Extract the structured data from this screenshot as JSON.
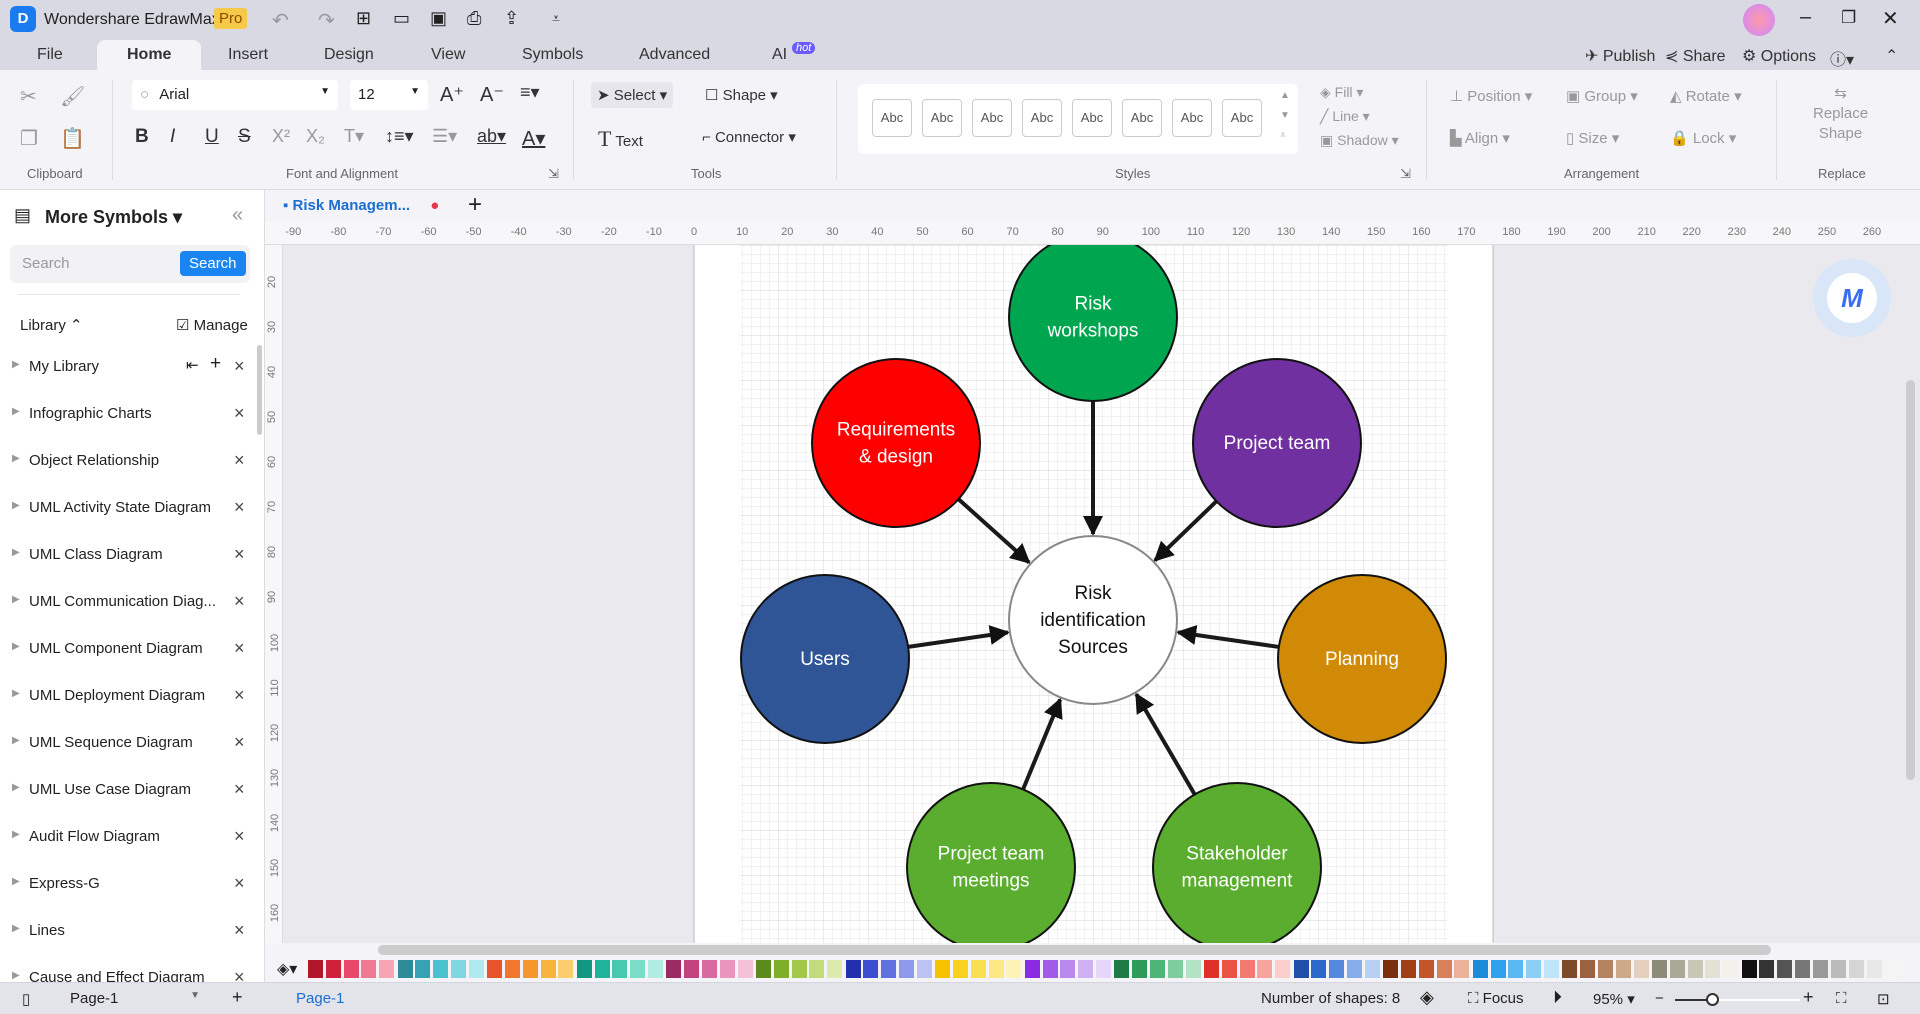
{
  "app": {
    "title": "Wondershare EdrawMax",
    "badge": "Pro"
  },
  "menu_tabs": [
    {
      "label": "File"
    },
    {
      "label": "Home"
    },
    {
      "label": "Insert"
    },
    {
      "label": "Design"
    },
    {
      "label": "View"
    },
    {
      "label": "Symbols"
    },
    {
      "label": "Advanced"
    },
    {
      "label": "AI"
    }
  ],
  "ai_badge": "hot",
  "top_actions": {
    "publish": "Publish",
    "share": "Share",
    "options": "Options"
  },
  "ribbon": {
    "clipboard": "Clipboard",
    "font_group": "Font and Alignment",
    "font": "Arial",
    "font_size": "12",
    "tools_group": "Tools",
    "select": "Select",
    "shape": "Shape",
    "text": "Text",
    "connector": "Connector",
    "styles_group": "Styles",
    "style_samples": [
      "Abc",
      "Abc",
      "Abc",
      "Abc",
      "Abc",
      "Abc",
      "Abc",
      "Abc"
    ],
    "fill": "Fill",
    "line": "Line",
    "shadow": "Shadow",
    "arrangement_group": "Arrangement",
    "position": "Position",
    "group": "Group",
    "rotate": "Rotate",
    "align": "Align",
    "size": "Size",
    "lock": "Lock",
    "replace_group": "Replace",
    "replace_shape_1": "Replace",
    "replace_shape_2": "Shape"
  },
  "sidebar": {
    "title": "More Symbols",
    "search_placeholder": "Search",
    "search_button": "Search",
    "library": "Library",
    "manage": "Manage",
    "items": [
      {
        "label": "My Library"
      },
      {
        "label": "Infographic Charts"
      },
      {
        "label": "Object Relationship"
      },
      {
        "label": "UML Activity State Diagram"
      },
      {
        "label": "UML Class Diagram"
      },
      {
        "label": "UML Communication Diag..."
      },
      {
        "label": "UML Component Diagram"
      },
      {
        "label": "UML Deployment Diagram"
      },
      {
        "label": "UML Sequence Diagram"
      },
      {
        "label": "UML Use Case Diagram"
      },
      {
        "label": "Audit Flow Diagram"
      },
      {
        "label": "Express-G"
      },
      {
        "label": "Lines"
      },
      {
        "label": "Cause and Effect Diagram"
      }
    ]
  },
  "document": {
    "tab": "Risk Managem..."
  },
  "ruler": {
    "h": [
      -90,
      -80,
      -70,
      -60,
      -50,
      -40,
      -30,
      -20,
      -10,
      0,
      10,
      20,
      30,
      40,
      50,
      60,
      70,
      80,
      90,
      100,
      110,
      120,
      130,
      140,
      150,
      160,
      170,
      180,
      190,
      200,
      210,
      220,
      230,
      240,
      250,
      260
    ],
    "v": [
      20,
      30,
      40,
      50,
      60,
      70,
      80,
      90,
      100,
      110,
      120,
      130,
      140,
      150,
      160
    ]
  },
  "diagram": {
    "center": {
      "line1": "Risk",
      "line2": "identification",
      "line3": "Sources",
      "color": "#ffffff"
    },
    "nodes": [
      {
        "line1": "Risk",
        "line2": "workshops",
        "color": "#00a64f"
      },
      {
        "line1": "Requirements",
        "line2": "& design",
        "color": "#ff0000"
      },
      {
        "line1": "Project team",
        "line2": "",
        "color": "#7030a0"
      },
      {
        "line1": "Users",
        "line2": "",
        "color": "#2f5597"
      },
      {
        "line1": "Planning",
        "line2": "",
        "color": "#d08a06"
      },
      {
        "line1": "Project team",
        "line2": "meetings",
        "color": "#5aad2e"
      },
      {
        "line1": "Stakeholder",
        "line2": "management",
        "color": "#5aad2e"
      }
    ]
  },
  "palette": [
    "#b3162b",
    "#d1213a",
    "#e8486a",
    "#f07a93",
    "#f6a5b5",
    "#2e8b9a",
    "#36a3b5",
    "#4cc2cf",
    "#7fd8e0",
    "#b0eaef",
    "#e8542a",
    "#f2782f",
    "#f5962f",
    "#f8b23e",
    "#fbcd6c",
    "#11977f",
    "#1fb39a",
    "#46c9b0",
    "#7bdcc8",
    "#b0ecdf",
    "#9c2b63",
    "#c2417f",
    "#d86aa0",
    "#e896bd",
    "#f3c2d9",
    "#5c8a1c",
    "#7fae28",
    "#a1c84a",
    "#c2dc7a",
    "#dcebad",
    "#2230b0",
    "#3b4ed0",
    "#6170e0",
    "#8e99ea",
    "#bcc3f3",
    "#f5c300",
    "#f8d21d",
    "#fadf50",
    "#fce986",
    "#fdf3b9",
    "#8a2be2",
    "#a25be8",
    "#b987ee",
    "#d0b1f4",
    "#e6d7fa",
    "#1e7b45",
    "#2e9b59",
    "#4fb577",
    "#7fcd9c",
    "#b3e3c4",
    "#e0302a",
    "#ea5246",
    "#f27a70",
    "#f7a49d",
    "#fbcecb",
    "#1f4fa8",
    "#2f68cc",
    "#5688de",
    "#86acea",
    "#b8cff4",
    "#7a2e0b",
    "#a03f12",
    "#c2562a",
    "#d8805c",
    "#ebb199",
    "#1b8ad8",
    "#2ea2ec",
    "#5ab8f2",
    "#8ccff6",
    "#bee5fa",
    "#7d4a2a",
    "#9a6240",
    "#b5825f",
    "#cfa88a",
    "#e6cfbd",
    "#8b8b7a",
    "#aaa998",
    "#c8c7b6",
    "#e2e1d3",
    "#f3f2ea",
    "#111111",
    "#333333",
    "#555555",
    "#777777",
    "#999999",
    "#bbbbbb",
    "#d5d5d5",
    "#e8e8e8",
    "#f5f5f5"
  ],
  "status": {
    "page_selector": "Page-1",
    "page_tab": "Page-1",
    "shapes": "Number of shapes: 8",
    "focus": "Focus",
    "zoom": "95%",
    "zoom_level": 95
  }
}
